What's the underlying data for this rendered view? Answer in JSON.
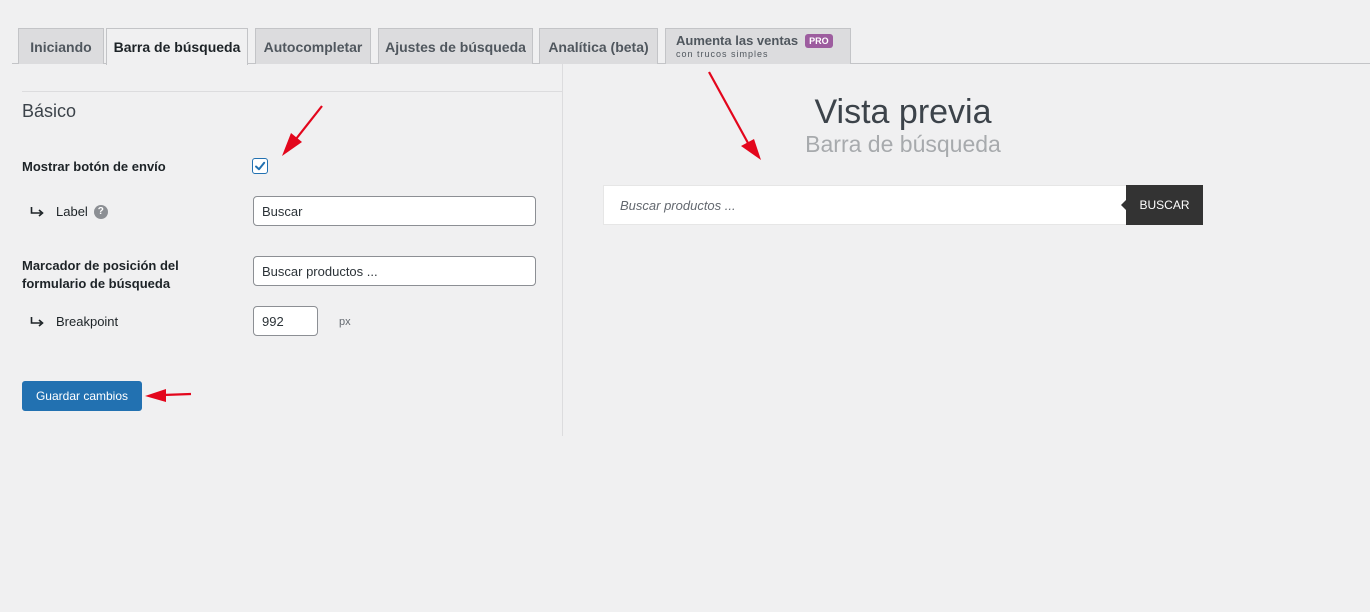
{
  "tabs": {
    "iniciando": "Iniciando",
    "barra": "Barra de búsqueda",
    "autocompletar": "Autocompletar",
    "ajustes": "Ajustes de búsqueda",
    "analitica": "Analítica (beta)",
    "ventas": "Aumenta las ventas",
    "ventas_badge": "PRO",
    "ventas_sub": "con trucos simples"
  },
  "settings": {
    "section_title": "Básico",
    "show_submit_label": "Mostrar botón de envío",
    "show_submit_checked": true,
    "label_label": "Label",
    "label_value": "Buscar",
    "placeholder_label_line1": "Marcador de posición del",
    "placeholder_label_line2": "formulario de búsqueda",
    "placeholder_value": "Buscar productos ...",
    "breakpoint_label": "Breakpoint",
    "breakpoint_value": "992",
    "breakpoint_unit": "px",
    "save_button": "Guardar cambios"
  },
  "preview": {
    "title": "Vista previa",
    "subtitle": "Barra de búsqueda",
    "search_placeholder": "Buscar productos ...",
    "search_button": "BUSCAR"
  },
  "icons": {
    "subitem": "subitem-arrow-icon",
    "help": "help-icon",
    "check": "checkmark-icon",
    "annotation": "red-arrow-icon"
  },
  "colors": {
    "primary": "#2271b1",
    "pro_badge": "#9d5d9f",
    "annotation": "#e3061c",
    "preview_button": "#333333"
  }
}
